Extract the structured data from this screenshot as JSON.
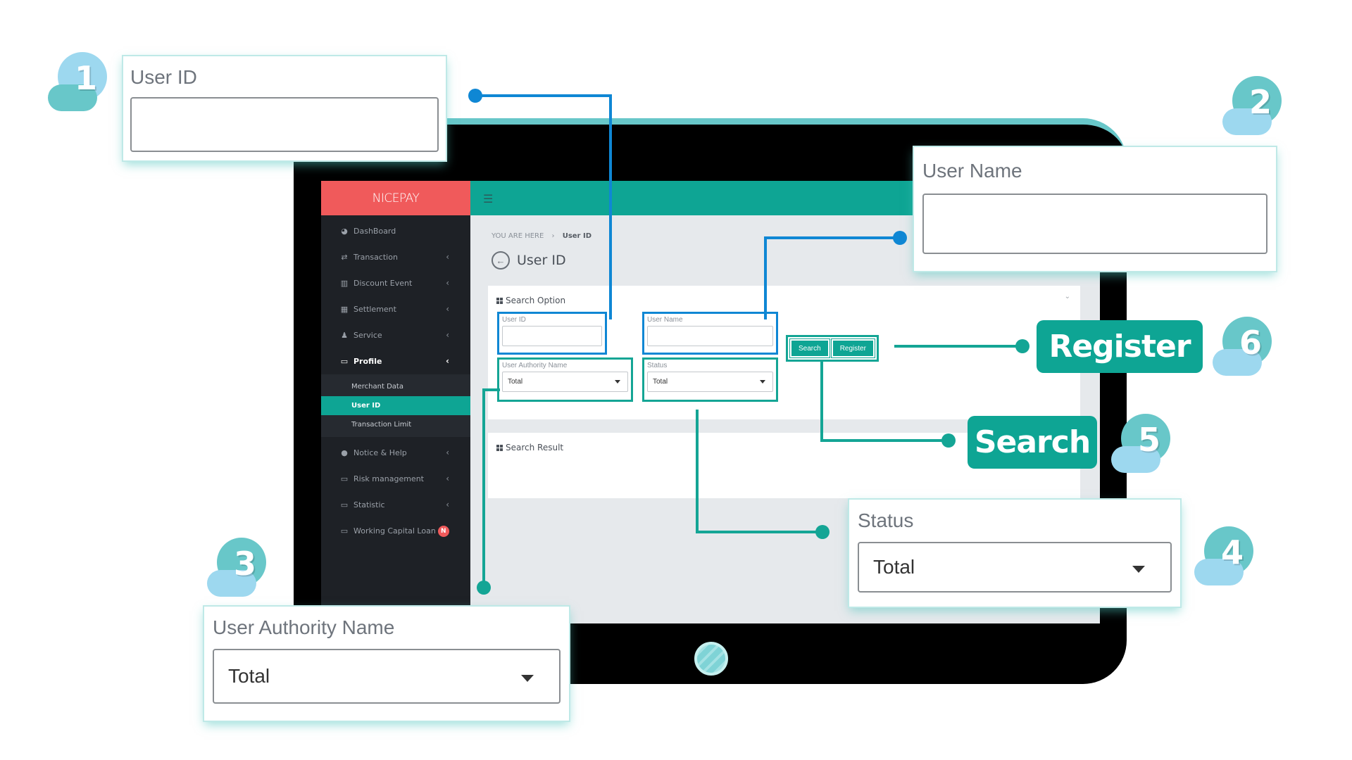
{
  "colors": {
    "brand_red": "#f05a5b",
    "accent_teal": "#0ea594",
    "highlight_blue": "#0f87d4",
    "badge_teal": "#68c7c9",
    "badge_light_blue": "#9dd8ef"
  },
  "app": {
    "brand": "NICEPAY",
    "menu_icon": "hamburger-icon"
  },
  "sidebar": {
    "items": [
      {
        "label": "DashBoard",
        "icon": "dashboard-icon",
        "glyph": "◕",
        "has_chevron": false
      },
      {
        "label": "Transaction",
        "icon": "exchange-icon",
        "glyph": "⇄",
        "has_chevron": true
      },
      {
        "label": "Discount Event",
        "icon": "bar-chart-icon",
        "glyph": "▥",
        "has_chevron": true
      },
      {
        "label": "Settlement",
        "icon": "calendar-icon",
        "glyph": "▦",
        "has_chevron": true
      },
      {
        "label": "Service",
        "icon": "users-icon",
        "glyph": "♟",
        "has_chevron": true
      },
      {
        "label": "Profile",
        "icon": "monitor-icon",
        "glyph": "▭",
        "has_chevron": true,
        "active": true
      }
    ],
    "submenu": [
      {
        "label": "Merchant Data"
      },
      {
        "label": "User ID",
        "active": true
      },
      {
        "label": "Transaction Limit"
      }
    ],
    "items_after": [
      {
        "label": "Notice & Help",
        "icon": "comment-icon",
        "glyph": "●",
        "has_chevron": true
      },
      {
        "label": "Risk management",
        "icon": "folder-icon",
        "glyph": "▭",
        "has_chevron": true
      },
      {
        "label": "Statistic",
        "icon": "folder-icon",
        "glyph": "▭",
        "has_chevron": true
      },
      {
        "label": "Working Capital Loan",
        "icon": "folder-icon",
        "glyph": "▭",
        "has_chevron": false,
        "badge": "N"
      }
    ],
    "chevron_glyph": "‹"
  },
  "breadcrumb": {
    "prefix": "YOU ARE HERE",
    "separator": "›",
    "current": "User ID"
  },
  "page": {
    "title": "User ID",
    "back_glyph": "←"
  },
  "search_option": {
    "title": "Search Option",
    "collapse_glyph": "⌄",
    "fields": {
      "user_id": {
        "label": "User ID",
        "value": ""
      },
      "user_name": {
        "label": "User Name",
        "value": ""
      },
      "user_authority_name": {
        "label": "User Authority Name",
        "selected": "Total"
      },
      "status": {
        "label": "Status",
        "selected": "Total"
      }
    },
    "buttons": {
      "search": "Search",
      "register": "Register"
    }
  },
  "search_result": {
    "title": "Search Result"
  },
  "callouts": {
    "user_id": {
      "step": "1",
      "label": "User ID",
      "value": ""
    },
    "user_name": {
      "step": "2",
      "label": "User Name",
      "value": ""
    },
    "user_authority_name": {
      "step": "3",
      "label": "User Authority Name",
      "selected": "Total"
    },
    "status": {
      "step": "4",
      "label": "Status",
      "selected": "Total"
    },
    "search": {
      "step": "5",
      "label": "Search"
    },
    "register": {
      "step": "6",
      "label": "Register"
    }
  }
}
